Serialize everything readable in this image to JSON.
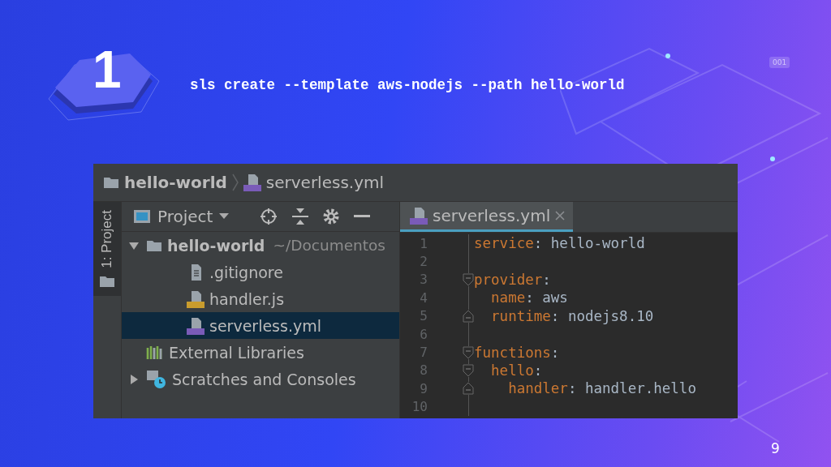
{
  "slide": {
    "step": "1",
    "command": "sls create --template aws-nodejs --path hello-world",
    "decor_badge": "001",
    "page_number": "9"
  },
  "ide": {
    "breadcrumb": [
      {
        "kind": "folder",
        "label": "hello-world"
      },
      {
        "kind": "yml",
        "label": "serverless.yml"
      }
    ],
    "tool_stripe": {
      "label": "1: Project"
    },
    "project_panel": {
      "title": "Project",
      "tree": [
        {
          "kind": "folder",
          "label": "hello-world",
          "path": "~/Documentos",
          "expanded": true,
          "selected": false,
          "children": [
            {
              "kind": "text",
              "label": ".gitignore",
              "selected": false
            },
            {
              "kind": "js",
              "label": "handler.js",
              "selected": false
            },
            {
              "kind": "yml",
              "label": "serverless.yml",
              "selected": true
            }
          ]
        },
        {
          "kind": "libraries",
          "label": "External Libraries",
          "selected": false
        },
        {
          "kind": "scratches",
          "label": "Scratches and Consoles",
          "expanded": false,
          "selected": false
        }
      ]
    },
    "editor": {
      "tabs": [
        {
          "label": "serverless.yml",
          "selected": true
        }
      ],
      "lines": [
        {
          "no": "1",
          "key": "service",
          "value": ": hello-world",
          "fold_start": false,
          "fold_end": false
        },
        {
          "no": "2",
          "fold_start": false,
          "fold_end": false
        },
        {
          "no": "3",
          "key": "provider",
          "value": ":",
          "fold_start": true,
          "fold_end": false
        },
        {
          "no": "4",
          "key": "  name",
          "value": ": aws",
          "fold_start": false,
          "fold_end": false
        },
        {
          "no": "5",
          "key": "  runtime",
          "value": ": nodejs8.10",
          "fold_start": false,
          "fold_end": true
        },
        {
          "no": "6",
          "fold_start": false,
          "fold_end": false
        },
        {
          "no": "7",
          "key": "functions",
          "value": ":",
          "fold_start": true,
          "fold_end": false
        },
        {
          "no": "8",
          "key": "  hello",
          "value": ":",
          "fold_start": true,
          "fold_end": false
        },
        {
          "no": "9",
          "key": "    handler",
          "value": ": handler.hello",
          "fold_start": false,
          "fold_end": true
        },
        {
          "no": "10",
          "fold_start": false,
          "fold_end": false
        }
      ]
    }
  }
}
